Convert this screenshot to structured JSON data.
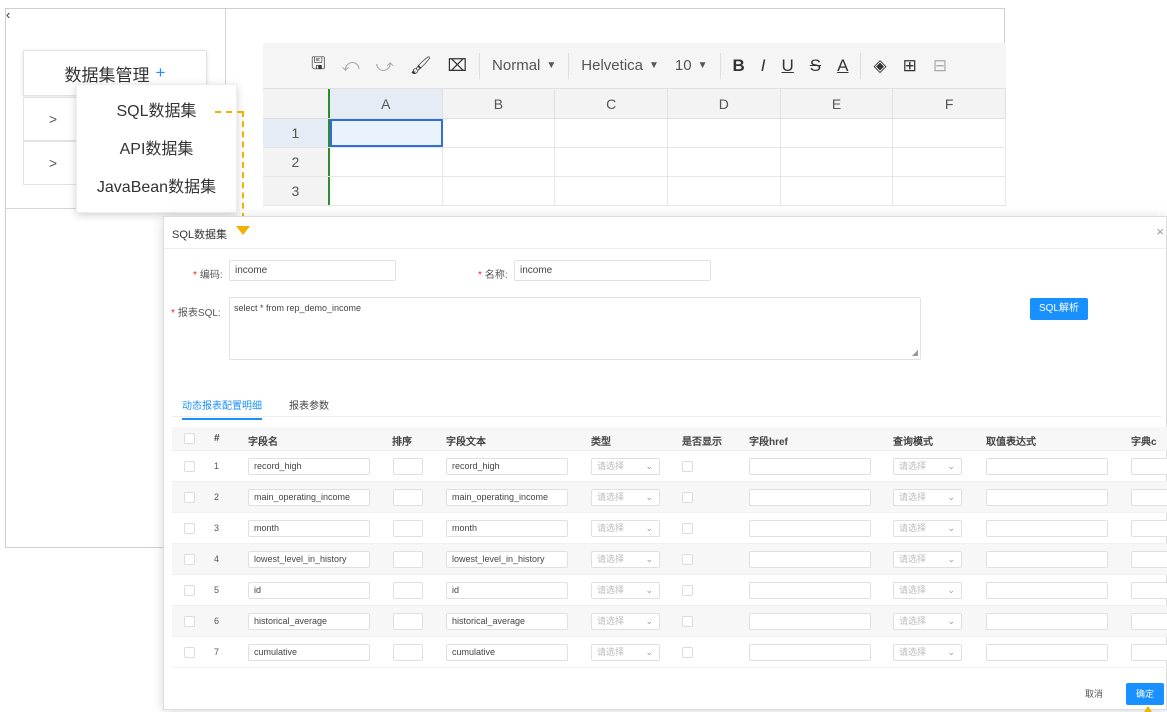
{
  "background": {
    "datasetManage": {
      "label": "数据集管理",
      "plus": "+"
    },
    "sideRowArrows": [
      ">",
      ">"
    ],
    "dropdown": [
      "SQL数据集",
      "API数据集",
      "JavaBean数据集"
    ],
    "toolbar": {
      "save": "🖫",
      "undo": "⤺",
      "redo": "⤻",
      "painter": "🖌",
      "clear": "⌧",
      "style": "Normal",
      "font": "Helvetica",
      "size": "10",
      "bold": "B",
      "italic": "I",
      "underline": "U",
      "strike": "S",
      "textColor": "A",
      "fill": "◈",
      "border": "⊞",
      "merge": "⊟"
    },
    "columns": [
      "A",
      "B",
      "C",
      "D",
      "E",
      "F"
    ],
    "rows": [
      "1",
      "2",
      "3"
    ]
  },
  "modal": {
    "title": "SQL数据集",
    "close": "×",
    "codeLabel": "编码:",
    "codeValue": "income",
    "nameLabel": "名称:",
    "nameValue": "income",
    "sqlLabel": "报表SQL:",
    "sqlValue": "select * from rep_demo_income",
    "parseButton": "SQL解析",
    "tabs": [
      "动态报表配置明细",
      "报表参数"
    ],
    "headers": [
      "#",
      "字段名",
      "排序",
      "字段文本",
      "类型",
      "是否显示",
      "字段href",
      "查询模式",
      "取值表达式",
      "字典c"
    ],
    "selectPlaceholder": "请选择",
    "rows": [
      {
        "no": "1",
        "field": "record_high",
        "text": "record_high"
      },
      {
        "no": "2",
        "field": "main_operating_income",
        "text": "main_operating_income"
      },
      {
        "no": "3",
        "field": "month",
        "text": "month"
      },
      {
        "no": "4",
        "field": "lowest_level_in_history",
        "text": "lowest_level_in_history"
      },
      {
        "no": "5",
        "field": "id",
        "text": "id"
      },
      {
        "no": "6",
        "field": "historical_average",
        "text": "historical_average"
      },
      {
        "no": "7",
        "field": "cumulative",
        "text": "cumulative"
      }
    ],
    "cancel": "取消",
    "confirm": "确定"
  }
}
